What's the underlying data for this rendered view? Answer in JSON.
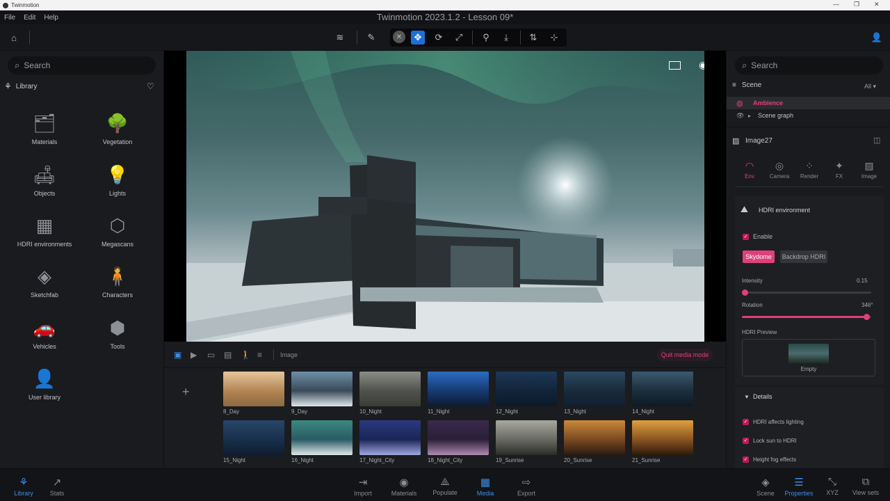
{
  "window": {
    "app_name": "Twinmotion",
    "document_title": "Twinmotion 2023.1.2 - Lesson 09*"
  },
  "menu": [
    "File",
    "Edit",
    "Help"
  ],
  "left": {
    "search_placeholder": "Search",
    "library_label": "Library",
    "items": [
      {
        "label": "Materials",
        "icon": "materials-icon",
        "glyph": "🗂"
      },
      {
        "label": "Vegetation",
        "icon": "tree-icon",
        "glyph": "🌳"
      },
      {
        "label": "Objects",
        "icon": "sofa-icon",
        "glyph": "🛋"
      },
      {
        "label": "Lights",
        "icon": "bulb-icon",
        "glyph": "💡"
      },
      {
        "label": "HDRI environments",
        "icon": "hdri-icon",
        "glyph": "▦"
      },
      {
        "label": "Megascans",
        "icon": "megascans-icon",
        "glyph": "⬡"
      },
      {
        "label": "Sketchfab",
        "icon": "cube-icon",
        "glyph": "◈"
      },
      {
        "label": "Characters",
        "icon": "person-icon",
        "glyph": "🧍"
      },
      {
        "label": "Vehicles",
        "icon": "car-icon",
        "glyph": "🚗"
      },
      {
        "label": "Tools",
        "icon": "tools-icon",
        "glyph": "⬢"
      },
      {
        "label": "User library",
        "icon": "user-library-icon",
        "glyph": "👤"
      }
    ]
  },
  "media": {
    "section_label": "Image",
    "quit_label": "Quit media mode",
    "thumbnails": [
      "8_Day",
      "9_Day",
      "10_Night",
      "11_Night",
      "12_Night",
      "13_Night",
      "14_Night",
      "15_Night",
      "16_Night",
      "17_Night_City",
      "18_Night_City",
      "19_Sunrise",
      "20_Sunrise",
      "21_Sunrise"
    ],
    "add_glyph": "+"
  },
  "right": {
    "search_placeholder": "Search",
    "scene_label": "Scene",
    "filter_label": "All",
    "ambience_label": "Ambience",
    "scene_graph_label": "Scene graph",
    "selected_item": "Image27",
    "tabs": [
      "Env",
      "Camera",
      "Render",
      "FX",
      "Image"
    ],
    "hdri_title": "HDRI environment",
    "enable_label": "Enable",
    "skydome_label": "Skydome",
    "backdrop_label": "Backdrop HDRI",
    "intensity_label": "Intensity",
    "intensity_value": "0.15",
    "intensity_fraction": 0.02,
    "rotation_label": "Rotation",
    "rotation_value": "346°",
    "rotation_fraction": 0.96,
    "preview_label": "HDRI Preview",
    "preview_name": "Empty",
    "details_label": "Details",
    "options": [
      "HDRI affects lighting",
      "Lock sun to HDRI",
      "Height fog effects"
    ]
  },
  "bottom": {
    "left": [
      "Library",
      "Stats"
    ],
    "center": [
      "Import",
      "Materials",
      "Populate",
      "Media",
      "Export"
    ],
    "right": [
      "Scene",
      "Properties",
      "XYZ",
      "View sets"
    ]
  },
  "colors": {
    "accent_blue": "#1e6fd9",
    "accent_pink": "#e0407a"
  }
}
